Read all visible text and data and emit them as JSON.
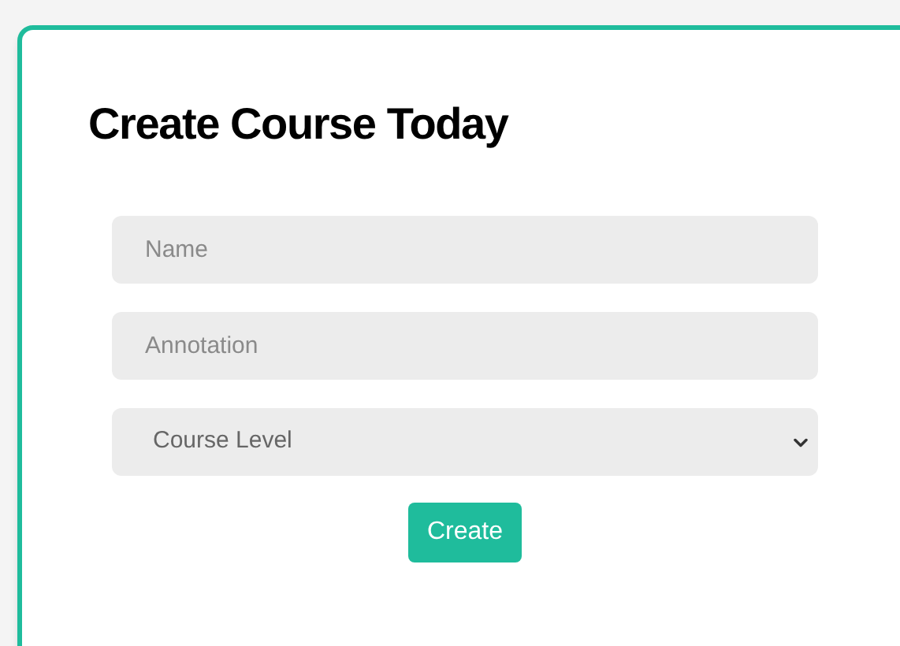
{
  "title": "Create Course Today",
  "fields": [
    {
      "kind": "text",
      "placeholder": "Name"
    },
    {
      "kind": "text",
      "placeholder": "Annotation"
    },
    {
      "kind": "select",
      "value": "Course Level"
    }
  ],
  "submit": "Create"
}
